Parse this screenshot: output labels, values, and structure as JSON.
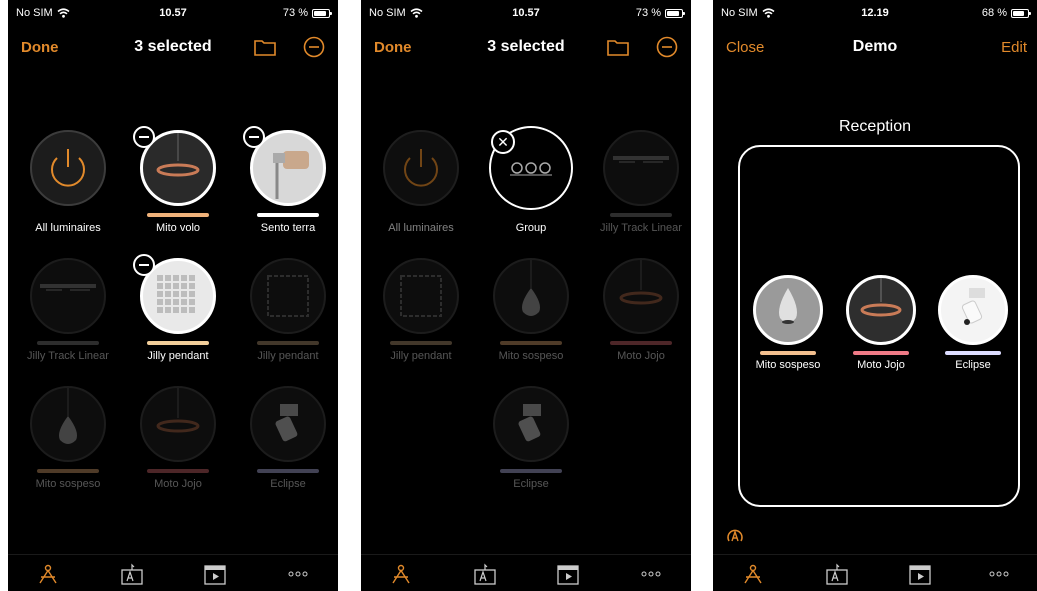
{
  "colors": {
    "accent": "#e28a2b"
  },
  "screens": [
    {
      "status": {
        "carrier": "No SIM",
        "time": "10.57",
        "battery": "73 %",
        "battery_level": 0.73
      },
      "nav": {
        "left": "Done",
        "title": "3 selected"
      },
      "tiles": [
        {
          "label": "All luminaires",
          "bar_color": null,
          "selected": false,
          "dim": false,
          "badge": false,
          "kind": "power"
        },
        {
          "label": "Mito volo",
          "bar_color": "#f0b27a",
          "selected": true,
          "dim": false,
          "badge": true,
          "kind": "ring"
        },
        {
          "label": "Sento terra",
          "bar_color": "#ffffff",
          "selected": true,
          "dim": false,
          "badge": true,
          "kind": "spot"
        },
        {
          "label": "Jilly Track Linear",
          "bar_color": "#8a8a8a",
          "selected": false,
          "dim": true,
          "badge": false,
          "kind": "track"
        },
        {
          "label": "Jilly pendant",
          "bar_color": "#f3cf9b",
          "selected": true,
          "dim": false,
          "badge": true,
          "kind": "grid"
        },
        {
          "label": "Jilly pendant",
          "bar_color": "#c9a77f",
          "selected": false,
          "dim": true,
          "badge": false,
          "kind": "grid"
        },
        {
          "label": "Mito sospeso",
          "bar_color": "#f0b27a",
          "selected": false,
          "dim": true,
          "badge": false,
          "kind": "drop"
        },
        {
          "label": "Moto Jojo",
          "bar_color": "#e8737a",
          "selected": false,
          "dim": true,
          "badge": false,
          "kind": "ring"
        },
        {
          "label": "Eclipse",
          "bar_color": "#c8c8ff",
          "selected": false,
          "dim": true,
          "badge": false,
          "kind": "spot"
        }
      ],
      "tabs": [
        "luminaires-tab-icon",
        "scenes-tab-icon",
        "sequences-tab-icon",
        "more-tab-icon"
      ]
    },
    {
      "status": {
        "carrier": "No SIM",
        "time": "10.57",
        "battery": "73 %",
        "battery_level": 0.73
      },
      "nav": {
        "left": "Done",
        "title": "3 selected"
      },
      "tiles": [
        {
          "label": "All luminaires",
          "bar_color": null,
          "selected": false,
          "dim": true,
          "badge": false,
          "kind": "power"
        },
        {
          "label": "Group",
          "bar_color": null,
          "selected": true,
          "dim": false,
          "badge": false,
          "kind": "group"
        },
        {
          "label": "Jilly Track Linear",
          "bar_color": "#8a8a8a",
          "selected": false,
          "dim": true,
          "badge": false,
          "kind": "track"
        },
        {
          "label": "Jilly pendant",
          "bar_color": "#c9a77f",
          "selected": false,
          "dim": true,
          "badge": false,
          "kind": "grid"
        },
        {
          "label": "Mito sospeso",
          "bar_color": "#f0b27a",
          "selected": false,
          "dim": true,
          "badge": false,
          "kind": "drop"
        },
        {
          "label": "Moto Jojo",
          "bar_color": "#e8737a",
          "selected": false,
          "dim": true,
          "badge": false,
          "kind": "ring"
        },
        {
          "label": "Eclipse",
          "bar_color": "#c8c8ff",
          "selected": false,
          "dim": true,
          "badge": false,
          "kind": "spot"
        }
      ],
      "tabs": [
        "luminaires-tab-icon",
        "scenes-tab-icon",
        "sequences-tab-icon",
        "more-tab-icon"
      ]
    },
    {
      "status": {
        "carrier": "No SIM",
        "time": "12.19",
        "battery": "68 %",
        "battery_level": 0.68
      },
      "nav": {
        "left": "Close",
        "title": "Demo",
        "right": "Edit"
      },
      "room": {
        "name": "Reception"
      },
      "room_tiles": [
        {
          "label": "Mito sospeso",
          "bar_color": "#f3c08f",
          "kind": "drop"
        },
        {
          "label": "Moto Jojo",
          "bar_color": "#ef7a86",
          "kind": "ring"
        },
        {
          "label": "Eclipse",
          "bar_color": "#dcdcff",
          "kind": "spot"
        }
      ],
      "tabs": [
        "luminaires-tab-icon",
        "scenes-tab-icon",
        "sequences-tab-icon",
        "more-tab-icon"
      ]
    }
  ]
}
